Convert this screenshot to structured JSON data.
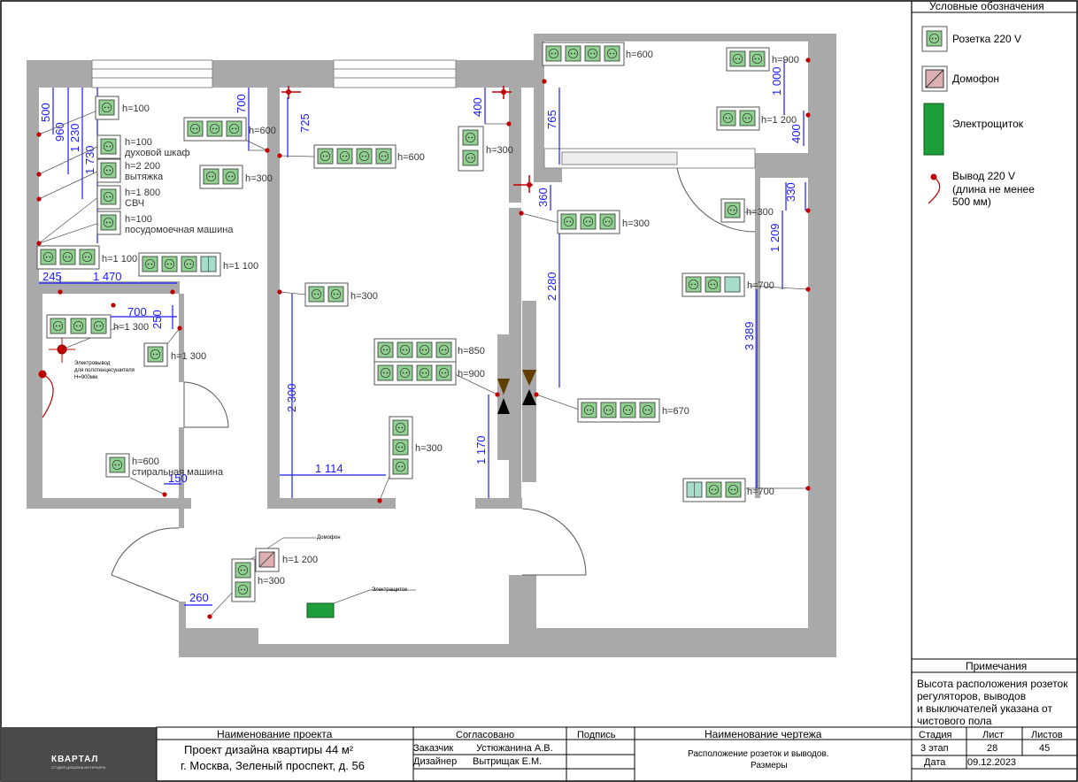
{
  "legend": {
    "title": "Условные обозначения",
    "socket_label": "Розетка 220 V",
    "intercom_label": "Домофон",
    "panel_label": "Электрощиток",
    "outlet_label_1": "Вывод 220 V",
    "outlet_label_2": "(длина не менее",
    "outlet_label_3": "500 мм)"
  },
  "notes": {
    "title": "Примечания",
    "line1": "Высота расположения розеток",
    "line2": "регуляторов, выводов",
    "line3": "и выключателей указана от",
    "line4": "чистового пола"
  },
  "plan": {
    "heights": {
      "k1": "h=100",
      "k2": "h=100",
      "k3": "h=2 200",
      "k4": "h=1 800",
      "k5": "h=100",
      "k6": "h=1 100",
      "k7": "h=1 100",
      "c1": "h=600",
      "c2": "h=300",
      "c3": "h=600",
      "r1": "h=300",
      "b1": "h=1 300",
      "b2": "h=1 300",
      "b3": "h=600",
      "l1": "h=300",
      "l2": "h=850",
      "l3": "h=900",
      "l4": "h=300",
      "h1": "h=1 200",
      "h2": "h=300",
      "tr1": "h=600",
      "tr2": "h=900",
      "tr3": "h=1 200",
      "tr4": "h=300",
      "tr5": "h=300",
      "tr6": "h=700",
      "tr7": "h=670",
      "tr8": "h=700"
    },
    "notes": {
      "k2": "духовой шкаф",
      "k3": "вытяжка",
      "k4": "СВЧ",
      "k5": "посудомоечная машина",
      "b3": "стиральная машина",
      "towel_1": "Электровывод",
      "towel_2": "для полотенцесушителя",
      "towel_3": "H=900мм",
      "intercom": "Домофон",
      "panel": "Электращиток"
    },
    "dims": {
      "d500": "500",
      "d960": "960",
      "d1230": "1 230",
      "d1730": "1 730",
      "d245": "245",
      "d1470": "1 470",
      "d700a": "700",
      "d250": "250",
      "d150": "150",
      "d260": "260",
      "d700b": "700",
      "d725": "725",
      "d400a": "400",
      "d2300": "2 300",
      "d1114": "1 114",
      "d1170": "1 170",
      "d765": "765",
      "d360": "360",
      "d2280": "2 280",
      "d1000": "1 000",
      "d400b": "400",
      "d330": "330",
      "d1209": "1 209",
      "d3389": "3 389"
    }
  },
  "title_block": {
    "logo": "КВАРТАЛ",
    "logo_sub": "СТУДИЯ ДИЗАЙНА ИНТЕРЬЕРА",
    "project_header": "Наименование проекта",
    "project_line1": "Проект дизайна квартиры 44 м²",
    "project_line2": "г. Москва, Зеленый проспект, д. 56",
    "agreed": "Согласовано",
    "signature": "Подпись",
    "customer_role": "Заказчик",
    "customer_name": "Устюжанина А.В.",
    "designer_role": "Дизайнер",
    "designer_name": "Вытрищак Е.М.",
    "drawing_header": "Наименование чертежа",
    "drawing_line1": "Расположение розеток и выводов.",
    "drawing_line2": "Размеры",
    "stage_label": "Стадия",
    "sheet_label": "Лист",
    "sheets_label": "Листов",
    "stage_value": "3 этап",
    "sheet_value": "28",
    "sheets_value": "45",
    "date_label": "Дата",
    "date_value": "09.12.2023"
  },
  "colors": {
    "socket": "#90d090",
    "panel": "#1e9e3a",
    "outlet": "#c00000",
    "wall": "#a9a9a9",
    "dimension": "#1a1aff"
  }
}
